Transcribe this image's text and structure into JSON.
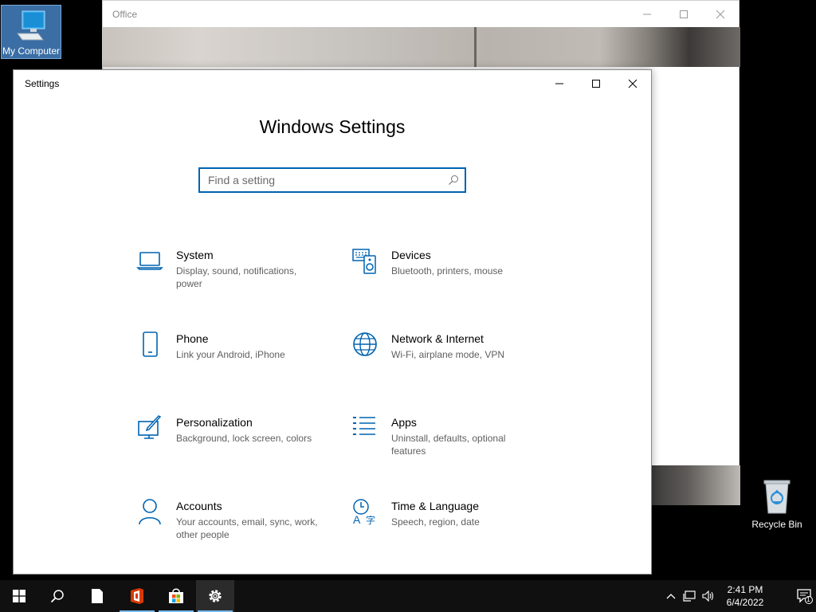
{
  "desktop": {
    "icons": [
      {
        "label": "My Computer"
      },
      {
        "label": "Recycle Bin"
      }
    ]
  },
  "office_window": {
    "title": "Office"
  },
  "settings_window": {
    "title": "Settings",
    "heading": "Windows Settings",
    "search": {
      "placeholder": "Find a setting",
      "value": ""
    },
    "accent_color": "#0063b1",
    "categories": [
      {
        "title": "System",
        "description": "Display, sound, notifications, power",
        "icon": "laptop-icon"
      },
      {
        "title": "Devices",
        "description": "Bluetooth, printers, mouse",
        "icon": "keyboard-speaker-icon"
      },
      {
        "title": "Phone",
        "description": "Link your Android, iPhone",
        "icon": "phone-icon"
      },
      {
        "title": "Network & Internet",
        "description": "Wi-Fi, airplane mode, VPN",
        "icon": "globe-icon"
      },
      {
        "title": "Personalization",
        "description": "Background, lock screen, colors",
        "icon": "paint-brush-icon"
      },
      {
        "title": "Apps",
        "description": "Uninstall, defaults, optional features",
        "icon": "list-icon"
      },
      {
        "title": "Accounts",
        "description": "Your accounts, email, sync, work, other people",
        "icon": "person-icon"
      },
      {
        "title": "Time & Language",
        "description": "Speech, region, date",
        "icon": "time-language-icon"
      }
    ]
  },
  "taskbar": {
    "items": [
      "start-icon",
      "search-icon",
      "file-icon",
      "office-icon",
      "store-icon",
      "settings-gear-icon"
    ],
    "clock": {
      "time": "2:41 PM",
      "date": "6/4/2022"
    },
    "notifications_count": "1"
  }
}
